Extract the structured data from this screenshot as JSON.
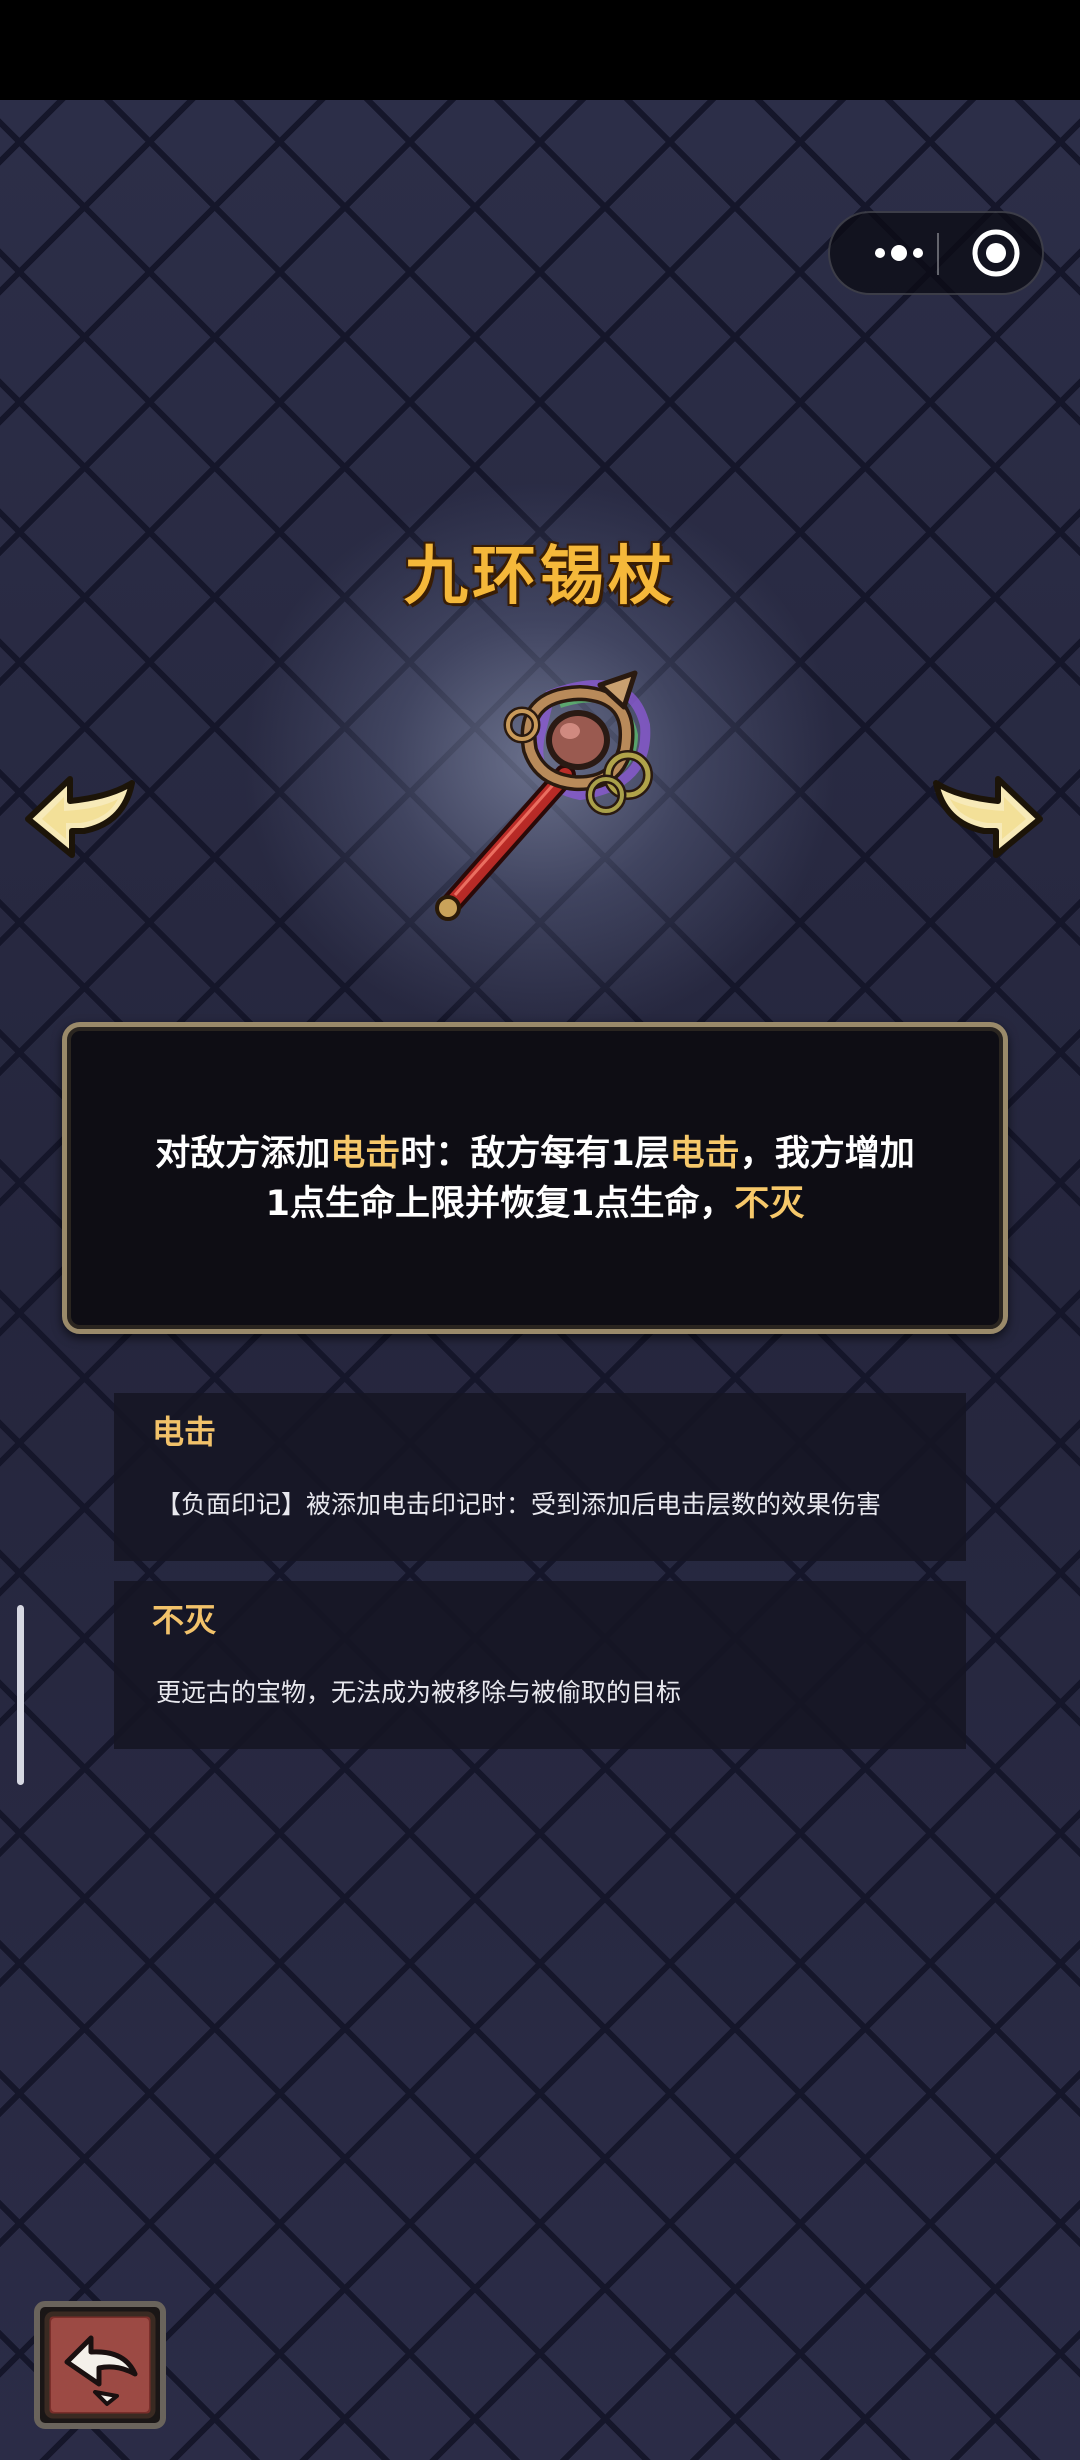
{
  "capsule": {
    "more_icon": "more-dots-icon",
    "target_icon": "target-circle-icon"
  },
  "item": {
    "name": "九环锡杖",
    "icon": "staff-icon"
  },
  "navigation": {
    "prev_icon": "arrow-left-icon",
    "next_icon": "arrow-right-icon",
    "back_icon": "return-arrow-icon"
  },
  "description": {
    "line1_part1": "对敌方添加",
    "line1_kw1": "电击",
    "line1_part2": "时：敌方每有1层",
    "line1_kw2": "电击",
    "line1_part3": "，我方增加",
    "line2_part1": "1点生命上限并恢复1点生命，",
    "line2_kw": "不灭"
  },
  "keywords": [
    {
      "title": "电击",
      "desc": "【负面印记】被添加电击印记时：受到添加后电击层数的效果伤害"
    },
    {
      "title": "不灭",
      "desc": "更远古的宝物，无法成为被移除与被偷取的目标"
    }
  ],
  "colors": {
    "title": "#f5b83a",
    "highlight": "#f6c86a",
    "box_border": "#9a8a6a",
    "background": "#262840"
  }
}
